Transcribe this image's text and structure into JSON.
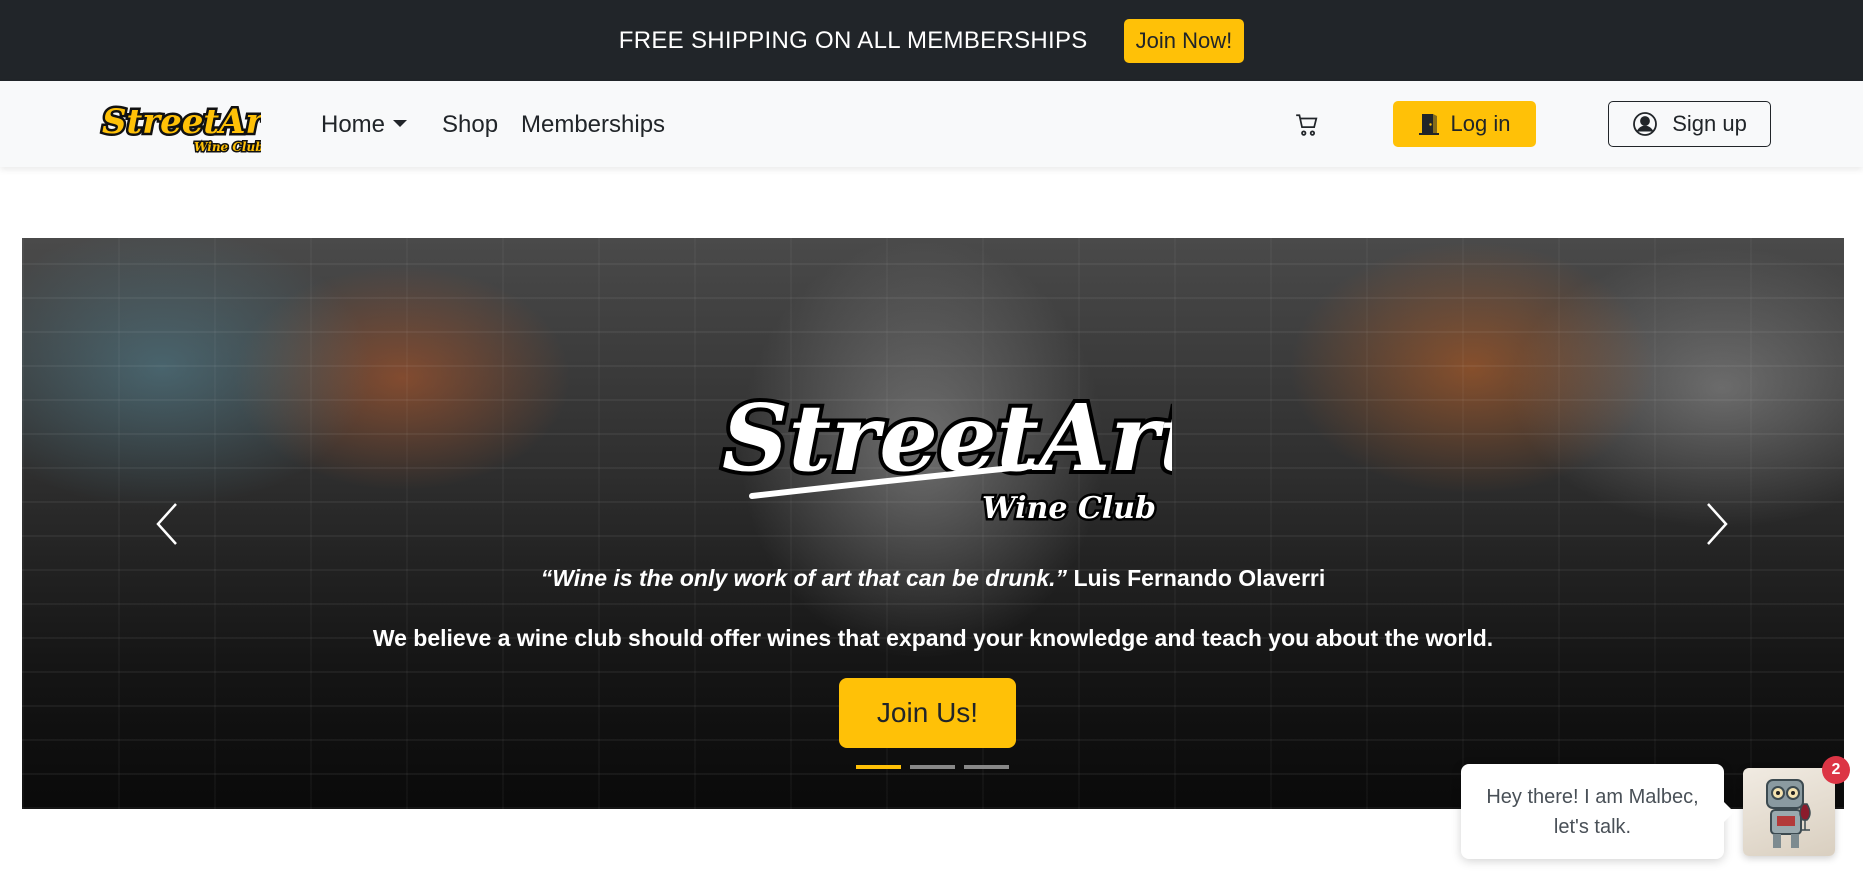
{
  "promo": {
    "text": "FREE SHIPPING ON ALL MEMBERSHIPS",
    "button_label": "Join Now!"
  },
  "nav": {
    "home_label": "Home",
    "shop_label": "Shop",
    "memberships_label": "Memberships",
    "login_label": "Log in",
    "signup_label": "Sign up"
  },
  "brand": {
    "logo_text_main": "StreetArt",
    "logo_text_sub": "Wine Club"
  },
  "hero": {
    "quote": "“Wine is the only work of art that can be drunk.”",
    "quote_author": "Luis Fernando Olaverri",
    "tagline": "We believe a wine club should offer wines that expand your knowledge and teach you about the world.",
    "cta_label": "Join Us!",
    "slides_total": 3,
    "active_slide": 1
  },
  "chat": {
    "message_line1": "Hey there! I am Malbec,",
    "message_line2": "let's talk.",
    "badge_count": "2"
  },
  "colors": {
    "accent": "#ffc107",
    "dark": "#212529",
    "badge": "#dc3545"
  },
  "icons": [
    "cart-icon",
    "door-icon",
    "user-circle-icon",
    "chevron-left-icon",
    "chevron-right-icon",
    "robot-avatar-icon"
  ]
}
